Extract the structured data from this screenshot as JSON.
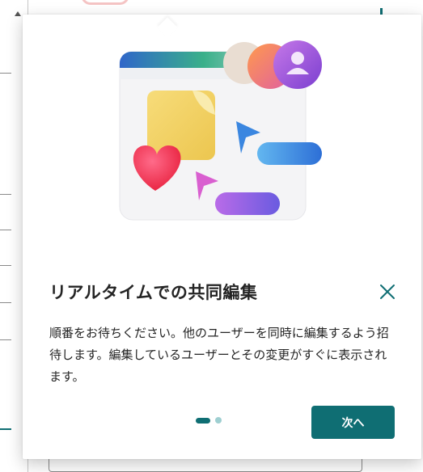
{
  "popover": {
    "title": "リアルタイムでの共同編集",
    "body": "順番をお待ちください。他のユーザーを同時に編集するよう招待します。編集しているユーザーとその変更がすぐに表示されます。",
    "next_label": "次へ",
    "page_indicator": {
      "current": 1,
      "total": 2
    }
  },
  "icons": {
    "close": "close-icon",
    "illustration": "collaboration-illustration"
  },
  "colors": {
    "accent": "#0f6e73",
    "dot_inactive": "#9ecfd1",
    "text": "#242424"
  }
}
